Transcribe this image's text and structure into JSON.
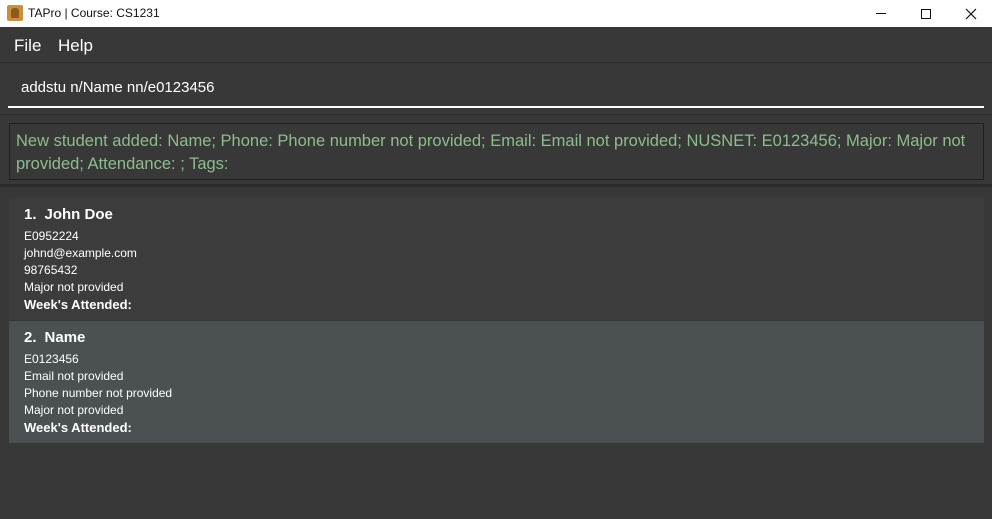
{
  "window": {
    "title": "TAPro | Course: CS1231",
    "icon": "app-icon",
    "controls": [
      "minimize-icon",
      "maximize-icon",
      "close-icon"
    ]
  },
  "menu": {
    "file": "File",
    "help": "Help"
  },
  "command": {
    "value": "addstu n/Name nn/e0123456"
  },
  "result": {
    "text": "New student added: Name; Phone: Phone number not provided; Email: Email not provided; NUSNET: E0123456; Major: Major not provided; Attendance: ; Tags:"
  },
  "students": [
    {
      "index": "1.",
      "name": "John Doe",
      "nusnet": "E0952224",
      "email": "johnd@example.com",
      "phone": "98765432",
      "major": "Major not provided",
      "attended": "Week's Attended:"
    },
    {
      "index": "2.",
      "name": "Name",
      "nusnet": "E0123456",
      "email": "Email not provided",
      "phone": "Phone number not provided",
      "major": "Major not provided",
      "attended": "Week's Attended:"
    }
  ],
  "colors": {
    "background": "#383838",
    "result_text": "#8fbc8f",
    "selected_card": "#4b5053"
  }
}
